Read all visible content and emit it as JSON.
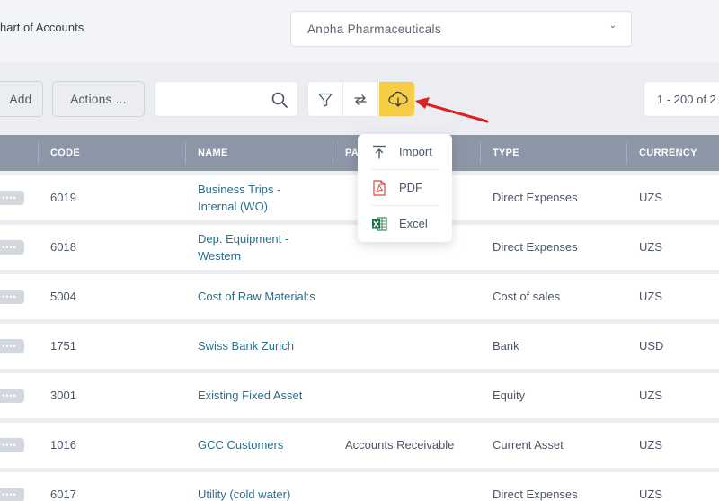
{
  "header": {
    "title": "hart of Accounts",
    "company": "Anpha Pharmaceuticals"
  },
  "toolbar": {
    "add_label": "Add",
    "actions_label": "Actions ...",
    "search_placeholder": "",
    "pagination": "1 - 200 of 2"
  },
  "export_menu": {
    "items": [
      {
        "label": "Import",
        "icon": "upload-icon"
      },
      {
        "label": "PDF",
        "icon": "pdf-icon"
      },
      {
        "label": "Excel",
        "icon": "excel-icon"
      }
    ]
  },
  "table": {
    "columns": [
      "CODE",
      "NAME",
      "PA",
      "TYPE",
      "CURRENCY"
    ],
    "rows": [
      {
        "code": "6019",
        "name": "Business Trips - Internal (WO)",
        "parent": "",
        "type": "Direct Expenses",
        "currency": "UZS"
      },
      {
        "code": "6018",
        "name": "Dep. Equipment - Western",
        "parent": "",
        "type": "Direct Expenses",
        "currency": "UZS"
      },
      {
        "code": "5004",
        "name": "Cost of Raw Material:s",
        "parent": "",
        "type": "Cost of sales",
        "currency": "UZS"
      },
      {
        "code": "1751",
        "name": "Swiss Bank Zurich",
        "parent": "",
        "type": "Bank",
        "currency": "USD"
      },
      {
        "code": "3001",
        "name": "Existing Fixed Asset",
        "parent": "",
        "type": "Equity",
        "currency": "UZS"
      },
      {
        "code": "1016",
        "name": "GCC Customers",
        "parent": "Accounts Receivable",
        "type": "Current Asset",
        "currency": "UZS"
      },
      {
        "code": "6017",
        "name": "Utility (cold water)",
        "parent": "",
        "type": "Direct Expenses",
        "currency": "UZS"
      }
    ]
  },
  "colors": {
    "accent": "#f7cd48",
    "header_bg": "#8c96a6",
    "link": "#2a6f8e",
    "arrow": "#e02020"
  }
}
